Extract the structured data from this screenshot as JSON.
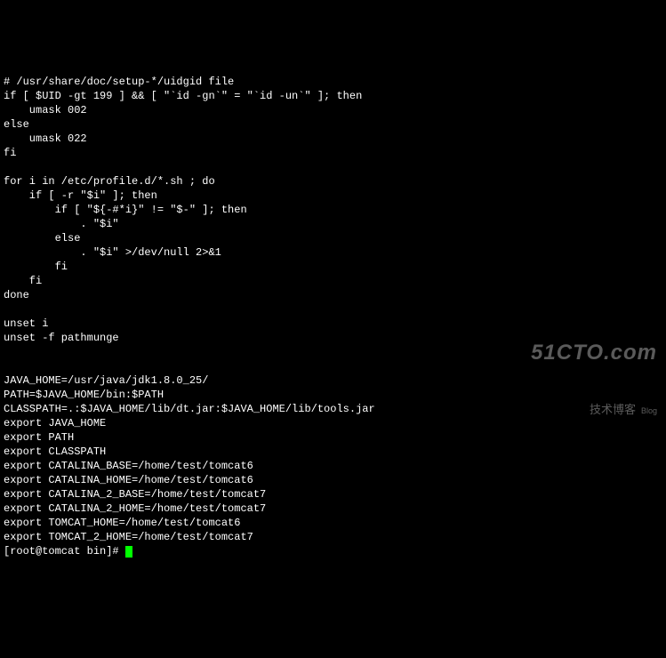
{
  "terminal": {
    "lines": [
      "# /usr/share/doc/setup-*/uidgid file",
      "if [ $UID -gt 199 ] && [ \"`id -gn`\" = \"`id -un`\" ]; then",
      "    umask 002",
      "else",
      "    umask 022",
      "fi",
      "",
      "for i in /etc/profile.d/*.sh ; do",
      "    if [ -r \"$i\" ]; then",
      "        if [ \"${-#*i}\" != \"$-\" ]; then",
      "            . \"$i\"",
      "        else",
      "            . \"$i\" >/dev/null 2>&1",
      "        fi",
      "    fi",
      "done",
      "",
      "unset i",
      "unset -f pathmunge",
      "",
      "",
      "JAVA_HOME=/usr/java/jdk1.8.0_25/",
      "PATH=$JAVA_HOME/bin:$PATH",
      "CLASSPATH=.:$JAVA_HOME/lib/dt.jar:$JAVA_HOME/lib/tools.jar",
      "export JAVA_HOME",
      "export PATH",
      "export CLASSPATH",
      "export CATALINA_BASE=/home/test/tomcat6",
      "export CATALINA_HOME=/home/test/tomcat6",
      "export CATALINA_2_BASE=/home/test/tomcat7",
      "export CATALINA_2_HOME=/home/test/tomcat7",
      "export TOMCAT_HOME=/home/test/tomcat6",
      "export TOMCAT_2_HOME=/home/test/tomcat7"
    ],
    "prompt": "[root@tomcat bin]# "
  },
  "watermark": {
    "domain": "51CTO.com",
    "sub": "技术博客",
    "blog": "Blog"
  }
}
